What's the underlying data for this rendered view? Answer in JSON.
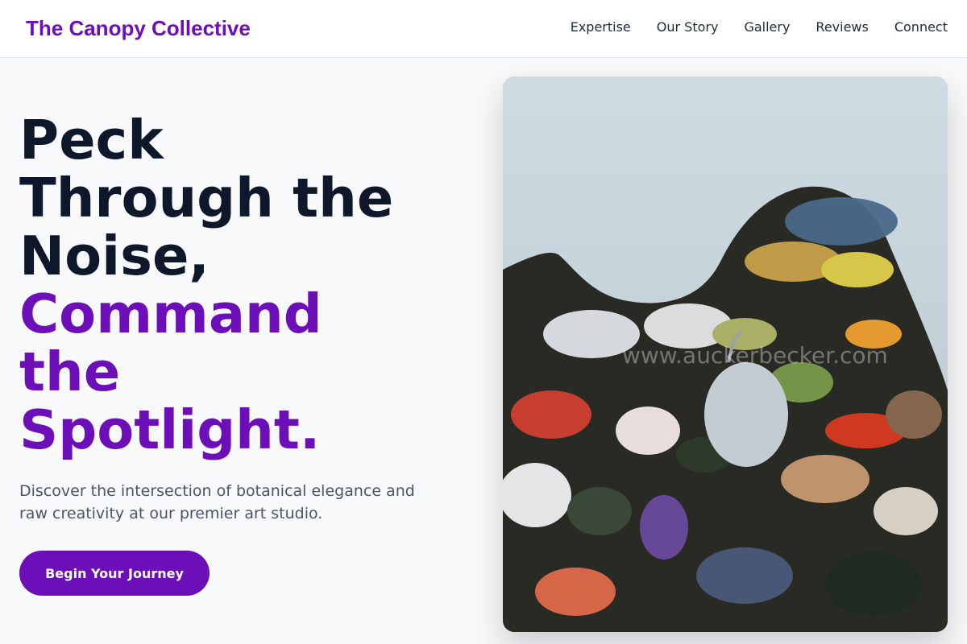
{
  "header": {
    "brand": "The Canopy Collective",
    "nav": [
      "Expertise",
      "Our Story",
      "Gallery",
      "Reviews",
      "Connect"
    ]
  },
  "hero": {
    "title_lines": [
      "Peck",
      "Through the",
      "Noise,"
    ],
    "accent_lines": [
      "Command",
      "the",
      "Spotlight."
    ],
    "subtitle": "Discover the intersection of botanical elegance and raw creativity at our premier art studio.",
    "cta_label": "Begin Your Journey"
  },
  "image": {
    "watermark": "www.auckerbecker.com",
    "subject": "paint-palette-photo"
  },
  "colors": {
    "accent": "#6d0fb8",
    "heading": "#0f172a",
    "text": "#4b5563",
    "background": "#f8f9fb"
  }
}
